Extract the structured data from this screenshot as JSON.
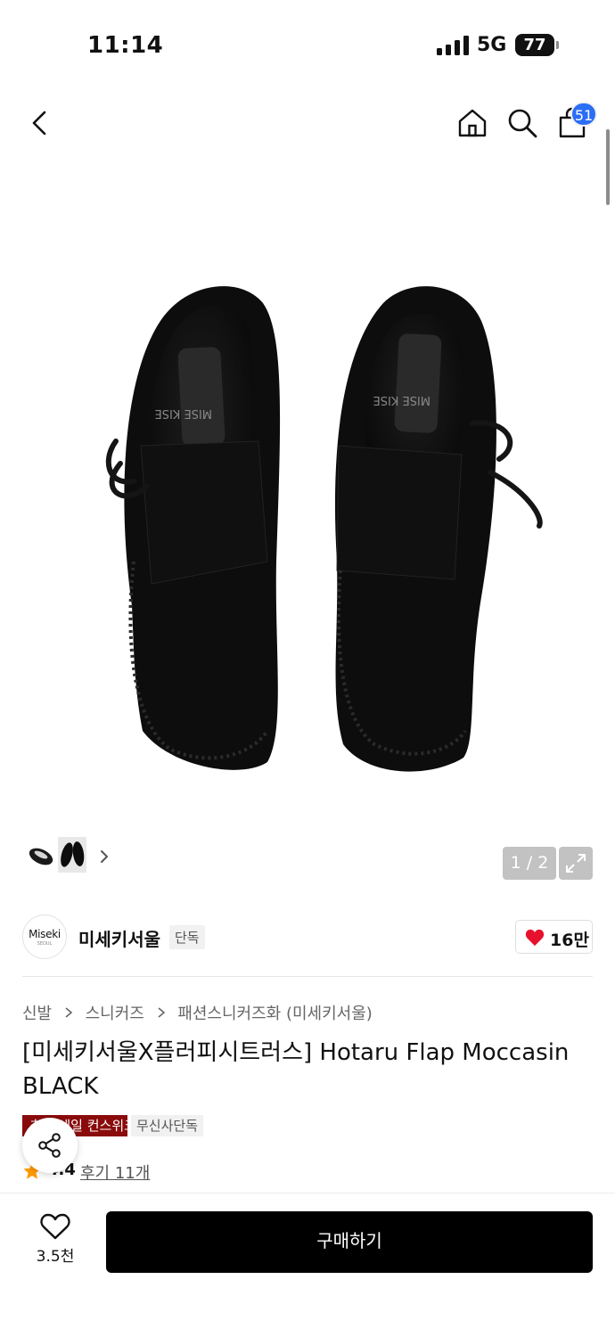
{
  "status_bar": {
    "time": "11:14",
    "network": "5G",
    "battery": "77"
  },
  "nav": {
    "cart_count": "51"
  },
  "gallery": {
    "pager": "1 / 2"
  },
  "brand": {
    "logo_text": "Miseki",
    "logo_subtext": "SEOUL",
    "name": "미세키서울",
    "tag": "단독",
    "like_count": "16만"
  },
  "breadcrumb": [
    "신발",
    "스니커즈",
    "패션스니커즈화 (미세키서울)"
  ],
  "product": {
    "title": "[미세키서울X플러피시트러스] Hotaru Flap Moccasin BLACK",
    "tag_red": "추가 세일 컨스위크",
    "tag_gray": "무신사단독",
    "rating": "4.4",
    "reviews": "후기 11개"
  },
  "bottom_bar": {
    "wish_count": "3.5천",
    "buy_label": "구매하기"
  },
  "colors": {
    "accent_badge": "#2b6ef5",
    "heart": "#e8112d",
    "tag_red": "#8a0b0b",
    "buy": "#000000",
    "star": "#ff9a00"
  }
}
